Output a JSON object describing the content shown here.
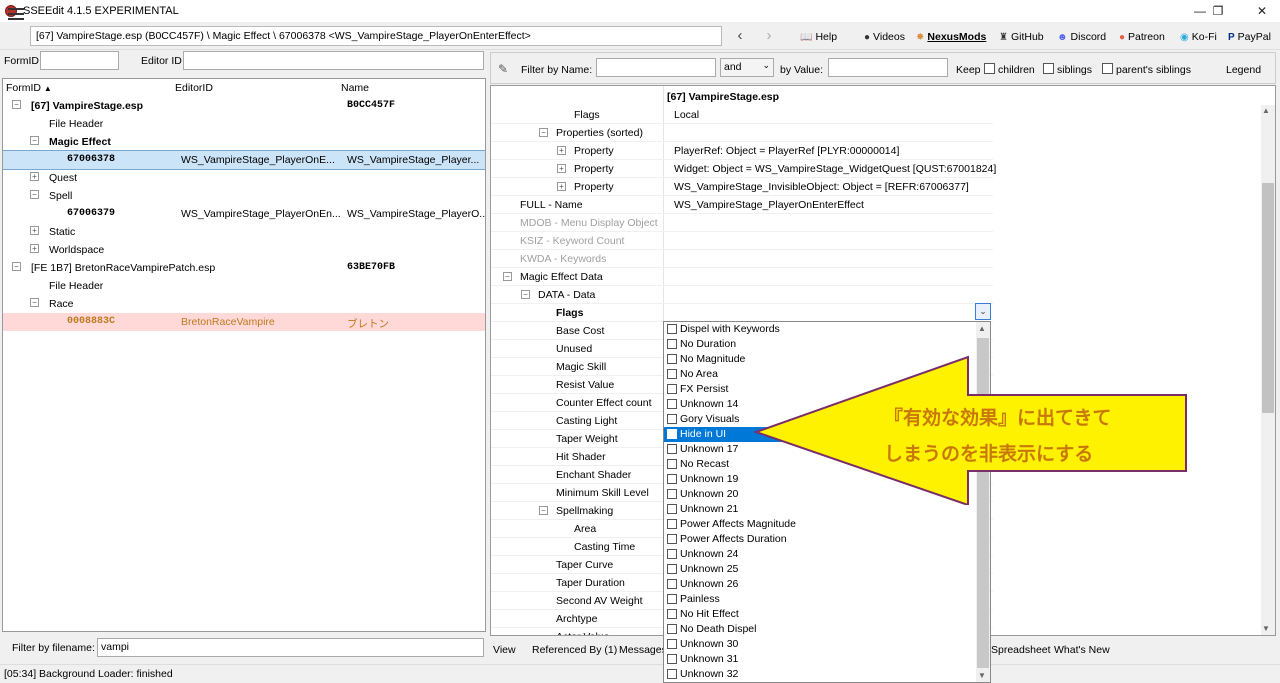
{
  "window": {
    "title": "SSEEdit 4.1.5 EXPERIMENTAL",
    "controls": {
      "minimize": "—",
      "maximize": "❐",
      "close": "✕"
    }
  },
  "toolbar": {
    "path": "[67] VampireStage.esp (B0CC457F) \\ Magic Effect \\ 67006378 <WS_VampireStage_PlayerOnEnterEffect>",
    "back": "‹",
    "forward": "›",
    "links": [
      {
        "icon": "book-icon",
        "glyph": "📖",
        "label": "Help"
      },
      {
        "icon": "video-icon",
        "glyph": "●",
        "label": "Videos"
      },
      {
        "icon": "nexus-icon",
        "glyph": "✸",
        "label": "NexusMods"
      },
      {
        "icon": "github-icon",
        "glyph": "♜",
        "label": "GitHub"
      },
      {
        "icon": "discord-icon",
        "glyph": "☻",
        "label": "Discord"
      },
      {
        "icon": "patreon-icon",
        "glyph": "●",
        "label": "Patreon"
      },
      {
        "icon": "kofi-icon",
        "glyph": "◉",
        "label": "Ko-Fi"
      },
      {
        "icon": "paypal-icon",
        "glyph": "P",
        "label": "PayPal"
      }
    ]
  },
  "left": {
    "formid_label": "FormID",
    "editorid_label": "Editor ID",
    "columns": [
      "FormID",
      "EditorID",
      "Name"
    ],
    "rows": [
      {
        "pm": "⊟",
        "c1": "[67] VampireStage.esp",
        "c2": "",
        "c3": "B0CC457F",
        "bold": true
      },
      {
        "pm": "",
        "c1": "File Header",
        "c2": "",
        "c3": ""
      },
      {
        "pm": "⊟",
        "c1": "Magic Effect",
        "c2": "",
        "c3": "",
        "bold": true
      },
      {
        "pm": "",
        "c1": "67006378",
        "c2": "WS_VampireStage_PlayerOnE...",
        "c3": "WS_VampireStage_Player...",
        "selected": true
      },
      {
        "pm": "⊞",
        "c1": "Quest",
        "c2": "",
        "c3": ""
      },
      {
        "pm": "⊟",
        "c1": "Spell",
        "c2": "",
        "c3": ""
      },
      {
        "pm": "",
        "c1": "67006379",
        "c2": "WS_VampireStage_PlayerOnEn...",
        "c3": "WS_VampireStage_PlayerO..."
      },
      {
        "pm": "⊞",
        "c1": "Static",
        "c2": "",
        "c3": ""
      },
      {
        "pm": "⊞",
        "c1": "Worldspace",
        "c2": "",
        "c3": ""
      },
      {
        "pm": "⊟",
        "c1": "[FE 1B7] BretonRaceVampirePatch.esp",
        "c2": "",
        "c3": "63BE70FB"
      },
      {
        "pm": "",
        "c1": "File Header",
        "c2": "",
        "c3": ""
      },
      {
        "pm": "⊟",
        "c1": "Race",
        "c2": "",
        "c3": ""
      },
      {
        "pm": "",
        "c1": "0008883C",
        "c2": "BretonRaceVampire",
        "c3": "ブレトン",
        "conflict": true
      }
    ],
    "filter_label": "Filter by filename:",
    "filter_value": "vampi"
  },
  "status": "[05:34] Background Loader: finished",
  "right": {
    "filter_label": "Filter by Name:",
    "and_value": "and",
    "by_value_label": "by Value:",
    "keep_label": "Keep",
    "children": "children",
    "siblings": "siblings",
    "parents": "parent's siblings",
    "legend": "Legend",
    "header_value": "[67] VampireStage.esp",
    "rows": [
      {
        "name": "Flags",
        "value": "Local",
        "pm": ""
      },
      {
        "name": "Properties (sorted)",
        "value": "",
        "pm": "⊟"
      },
      {
        "name": "Property",
        "value": "PlayerRef: Object = PlayerRef [PLYR:00000014]",
        "pm": "⊞"
      },
      {
        "name": "Property",
        "value": "Widget: Object = WS_VampireStage_WidgetQuest [QUST:67001824]",
        "pm": "⊞"
      },
      {
        "name": "Property",
        "value": "WS_VampireStage_InvisibleObject: Object = [REFR:67006377]",
        "pm": "⊞"
      },
      {
        "name": "FULL - Name",
        "value": "WS_VampireStage_PlayerOnEnterEffect",
        "pm": ""
      },
      {
        "name": "MDOB - Menu Display Object",
        "value": "",
        "pm": "",
        "gray": true
      },
      {
        "name": "KSIZ - Keyword Count",
        "value": "",
        "pm": "",
        "gray": true
      },
      {
        "name": "KWDA - Keywords",
        "value": "",
        "pm": "",
        "gray": true
      },
      {
        "name": "Magic Effect Data",
        "value": "",
        "pm": "⊟"
      },
      {
        "name": "DATA - Data",
        "value": "",
        "pm": "⊟"
      },
      {
        "name": "Flags",
        "value": "",
        "pm": ""
      },
      {
        "name": "Base Cost",
        "value": "",
        "pm": ""
      },
      {
        "name": "Unused",
        "value": "",
        "pm": ""
      },
      {
        "name": "Magic Skill",
        "value": "",
        "pm": ""
      },
      {
        "name": "Resist Value",
        "value": "",
        "pm": ""
      },
      {
        "name": "Counter Effect count",
        "value": "",
        "pm": ""
      },
      {
        "name": "Casting Light",
        "value": "",
        "pm": ""
      },
      {
        "name": "Taper Weight",
        "value": "",
        "pm": ""
      },
      {
        "name": "Hit Shader",
        "value": "",
        "pm": ""
      },
      {
        "name": "Enchant Shader",
        "value": "",
        "pm": ""
      },
      {
        "name": "Minimum Skill Level",
        "value": "",
        "pm": ""
      },
      {
        "name": "Spellmaking",
        "value": "",
        "pm": "⊟"
      },
      {
        "name": "Area",
        "value": "",
        "pm": ""
      },
      {
        "name": "Casting Time",
        "value": "",
        "pm": ""
      },
      {
        "name": "Taper Curve",
        "value": "",
        "pm": ""
      },
      {
        "name": "Taper Duration",
        "value": "",
        "pm": ""
      },
      {
        "name": "Second AV Weight",
        "value": "",
        "pm": ""
      },
      {
        "name": "Archtype",
        "value": "",
        "pm": ""
      },
      {
        "name": "Actor Value",
        "value": "",
        "pm": ""
      }
    ],
    "tabs": [
      "View",
      "Referenced By (1)",
      "Messages",
      "Spreadsheet",
      "What's New"
    ]
  },
  "dropdown": {
    "arrow": "⌄",
    "options": [
      {
        "label": "Dispel with Keywords"
      },
      {
        "label": "No Duration"
      },
      {
        "label": "No Magnitude"
      },
      {
        "label": "No Area"
      },
      {
        "label": "FX Persist"
      },
      {
        "label": "Unknown 14"
      },
      {
        "label": "Gory Visuals"
      },
      {
        "label": "Hide in UI",
        "selected": true
      },
      {
        "label": "Unknown 17"
      },
      {
        "label": "No Recast"
      },
      {
        "label": "Unknown 19"
      },
      {
        "label": "Unknown 20"
      },
      {
        "label": "Unknown 21"
      },
      {
        "label": "Power Affects Magnitude"
      },
      {
        "label": "Power Affects Duration"
      },
      {
        "label": "Unknown 24"
      },
      {
        "label": "Unknown 25"
      },
      {
        "label": "Unknown 26"
      },
      {
        "label": "Painless"
      },
      {
        "label": "No Hit Effect"
      },
      {
        "label": "No Death Dispel"
      },
      {
        "label": "Unknown 30"
      },
      {
        "label": "Unknown 31"
      },
      {
        "label": "Unknown 32"
      }
    ]
  },
  "annotation": {
    "line1": "『有効な効果』に出てきて",
    "line2": "しまうのを非表示にする",
    "fill": "#fff200",
    "stroke": "#7b2d6a",
    "text_color": "#c8780a"
  }
}
